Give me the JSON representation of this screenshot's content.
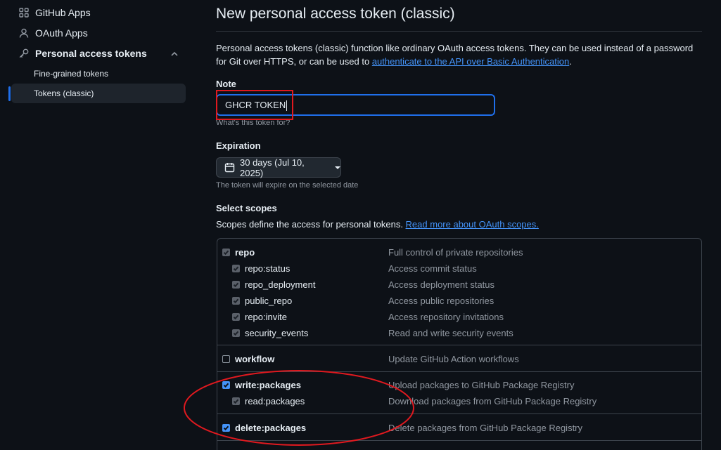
{
  "sidebar": {
    "github_apps": "GitHub Apps",
    "oauth_apps": "OAuth Apps",
    "personal_access_tokens": "Personal access tokens",
    "fine_grained": "Fine-grained tokens",
    "tokens_classic": "Tokens (classic)"
  },
  "main": {
    "title": "New personal access token (classic)",
    "intro_text": "Personal access tokens (classic) function like ordinary OAuth access tokens. They can be used instead of a password for Git over HTTPS, or can be used to ",
    "intro_link": "authenticate to the API over Basic Authentication",
    "intro_end": ".",
    "note_label": "Note",
    "note_value": "GHCR TOKEN",
    "note_hint": "What's this token for?",
    "expiration_label": "Expiration",
    "expiration_value": "30 days (Jul 10, 2025)",
    "expiration_hint": "The token will expire on the selected date",
    "scopes_label": "Select scopes",
    "scopes_desc": "Scopes define the access for personal tokens. ",
    "scopes_link": "Read more about OAuth scopes."
  },
  "scopes": [
    {
      "name": "repo",
      "desc": "Full control of private repositories",
      "state": "disabled-checked",
      "parent": true
    },
    {
      "name": "repo:status",
      "desc": "Access commit status",
      "state": "disabled-checked",
      "parent": false
    },
    {
      "name": "repo_deployment",
      "desc": "Access deployment status",
      "state": "disabled-checked",
      "parent": false
    },
    {
      "name": "public_repo",
      "desc": "Access public repositories",
      "state": "disabled-checked",
      "parent": false
    },
    {
      "name": "repo:invite",
      "desc": "Access repository invitations",
      "state": "disabled-checked",
      "parent": false
    },
    {
      "name": "security_events",
      "desc": "Read and write security events",
      "state": "disabled-checked",
      "parent": false
    },
    {
      "name": "workflow",
      "desc": "Update GitHub Action workflows",
      "state": "unchecked",
      "parent": true
    },
    {
      "name": "write:packages",
      "desc": "Upload packages to GitHub Package Registry",
      "state": "checked",
      "parent": true
    },
    {
      "name": "read:packages",
      "desc": "Download packages from GitHub Package Registry",
      "state": "disabled-checked",
      "parent": false
    },
    {
      "name": "delete:packages",
      "desc": "Delete packages from GitHub Package Registry",
      "state": "checked",
      "parent": true
    }
  ],
  "colors": {
    "background": "#0d1117",
    "accent": "#1f6feb",
    "link": "#4493f8",
    "annotation": "#e0191f"
  }
}
